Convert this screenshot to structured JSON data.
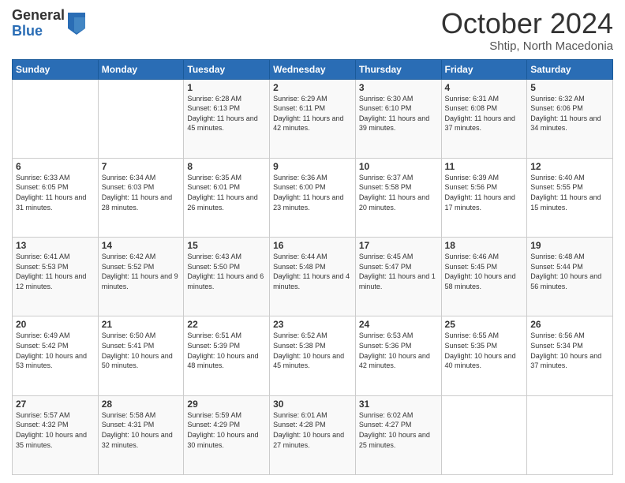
{
  "logo": {
    "general": "General",
    "blue": "Blue"
  },
  "header": {
    "month": "October 2024",
    "location": "Shtip, North Macedonia"
  },
  "days_of_week": [
    "Sunday",
    "Monday",
    "Tuesday",
    "Wednesday",
    "Thursday",
    "Friday",
    "Saturday"
  ],
  "weeks": [
    [
      {
        "day": "",
        "info": ""
      },
      {
        "day": "",
        "info": ""
      },
      {
        "day": "1",
        "info": "Sunrise: 6:28 AM\nSunset: 6:13 PM\nDaylight: 11 hours and 45 minutes."
      },
      {
        "day": "2",
        "info": "Sunrise: 6:29 AM\nSunset: 6:11 PM\nDaylight: 11 hours and 42 minutes."
      },
      {
        "day": "3",
        "info": "Sunrise: 6:30 AM\nSunset: 6:10 PM\nDaylight: 11 hours and 39 minutes."
      },
      {
        "day": "4",
        "info": "Sunrise: 6:31 AM\nSunset: 6:08 PM\nDaylight: 11 hours and 37 minutes."
      },
      {
        "day": "5",
        "info": "Sunrise: 6:32 AM\nSunset: 6:06 PM\nDaylight: 11 hours and 34 minutes."
      }
    ],
    [
      {
        "day": "6",
        "info": "Sunrise: 6:33 AM\nSunset: 6:05 PM\nDaylight: 11 hours and 31 minutes."
      },
      {
        "day": "7",
        "info": "Sunrise: 6:34 AM\nSunset: 6:03 PM\nDaylight: 11 hours and 28 minutes."
      },
      {
        "day": "8",
        "info": "Sunrise: 6:35 AM\nSunset: 6:01 PM\nDaylight: 11 hours and 26 minutes."
      },
      {
        "day": "9",
        "info": "Sunrise: 6:36 AM\nSunset: 6:00 PM\nDaylight: 11 hours and 23 minutes."
      },
      {
        "day": "10",
        "info": "Sunrise: 6:37 AM\nSunset: 5:58 PM\nDaylight: 11 hours and 20 minutes."
      },
      {
        "day": "11",
        "info": "Sunrise: 6:39 AM\nSunset: 5:56 PM\nDaylight: 11 hours and 17 minutes."
      },
      {
        "day": "12",
        "info": "Sunrise: 6:40 AM\nSunset: 5:55 PM\nDaylight: 11 hours and 15 minutes."
      }
    ],
    [
      {
        "day": "13",
        "info": "Sunrise: 6:41 AM\nSunset: 5:53 PM\nDaylight: 11 hours and 12 minutes."
      },
      {
        "day": "14",
        "info": "Sunrise: 6:42 AM\nSunset: 5:52 PM\nDaylight: 11 hours and 9 minutes."
      },
      {
        "day": "15",
        "info": "Sunrise: 6:43 AM\nSunset: 5:50 PM\nDaylight: 11 hours and 6 minutes."
      },
      {
        "day": "16",
        "info": "Sunrise: 6:44 AM\nSunset: 5:48 PM\nDaylight: 11 hours and 4 minutes."
      },
      {
        "day": "17",
        "info": "Sunrise: 6:45 AM\nSunset: 5:47 PM\nDaylight: 11 hours and 1 minute."
      },
      {
        "day": "18",
        "info": "Sunrise: 6:46 AM\nSunset: 5:45 PM\nDaylight: 10 hours and 58 minutes."
      },
      {
        "day": "19",
        "info": "Sunrise: 6:48 AM\nSunset: 5:44 PM\nDaylight: 10 hours and 56 minutes."
      }
    ],
    [
      {
        "day": "20",
        "info": "Sunrise: 6:49 AM\nSunset: 5:42 PM\nDaylight: 10 hours and 53 minutes."
      },
      {
        "day": "21",
        "info": "Sunrise: 6:50 AM\nSunset: 5:41 PM\nDaylight: 10 hours and 50 minutes."
      },
      {
        "day": "22",
        "info": "Sunrise: 6:51 AM\nSunset: 5:39 PM\nDaylight: 10 hours and 48 minutes."
      },
      {
        "day": "23",
        "info": "Sunrise: 6:52 AM\nSunset: 5:38 PM\nDaylight: 10 hours and 45 minutes."
      },
      {
        "day": "24",
        "info": "Sunrise: 6:53 AM\nSunset: 5:36 PM\nDaylight: 10 hours and 42 minutes."
      },
      {
        "day": "25",
        "info": "Sunrise: 6:55 AM\nSunset: 5:35 PM\nDaylight: 10 hours and 40 minutes."
      },
      {
        "day": "26",
        "info": "Sunrise: 6:56 AM\nSunset: 5:34 PM\nDaylight: 10 hours and 37 minutes."
      }
    ],
    [
      {
        "day": "27",
        "info": "Sunrise: 5:57 AM\nSunset: 4:32 PM\nDaylight: 10 hours and 35 minutes."
      },
      {
        "day": "28",
        "info": "Sunrise: 5:58 AM\nSunset: 4:31 PM\nDaylight: 10 hours and 32 minutes."
      },
      {
        "day": "29",
        "info": "Sunrise: 5:59 AM\nSunset: 4:29 PM\nDaylight: 10 hours and 30 minutes."
      },
      {
        "day": "30",
        "info": "Sunrise: 6:01 AM\nSunset: 4:28 PM\nDaylight: 10 hours and 27 minutes."
      },
      {
        "day": "31",
        "info": "Sunrise: 6:02 AM\nSunset: 4:27 PM\nDaylight: 10 hours and 25 minutes."
      },
      {
        "day": "",
        "info": ""
      },
      {
        "day": "",
        "info": ""
      }
    ]
  ]
}
